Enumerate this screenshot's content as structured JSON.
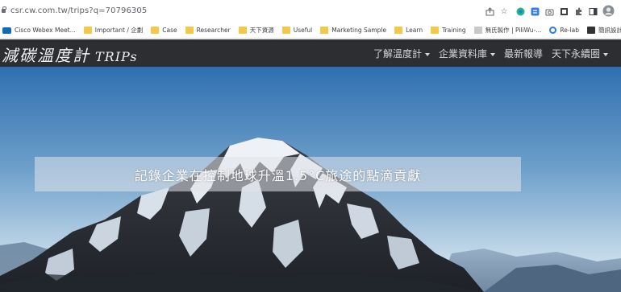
{
  "browser": {
    "url": "csr.cw.com.tw/trips?q=70796305",
    "extension_icons": [
      "share-icon",
      "star-icon",
      "color-ext-icon",
      "sync-ext-icon",
      "camera-icon",
      "square-ext-icon",
      "puzzle-icon",
      "sidepanel-icon",
      "profile-avatar-icon"
    ],
    "bookmarks": [
      {
        "label": "Cisco Webex Meet...",
        "icon": "cisco-icon"
      },
      {
        "label": "Important / 企劃",
        "icon": "folder-icon"
      },
      {
        "label": "Case",
        "icon": "folder-icon"
      },
      {
        "label": "Researcher",
        "icon": "folder-icon"
      },
      {
        "label": "天下資源",
        "icon": "folder-icon"
      },
      {
        "label": "Useful",
        "icon": "folder-icon"
      },
      {
        "label": "Marketing Sample",
        "icon": "folder-icon"
      },
      {
        "label": "Learn",
        "icon": "folder-icon"
      },
      {
        "label": "Training",
        "icon": "folder-icon"
      },
      {
        "label": "無氏製作 | PiliWu-...",
        "icon": "page-icon"
      },
      {
        "label": "Re-lab",
        "icon": "relab-icon"
      },
      {
        "label": "簡訊設計",
        "icon": "dark-icon"
      }
    ]
  },
  "site": {
    "brand_cn": "減碳溫度計",
    "brand_en": "TRIPs",
    "menu": [
      {
        "label": "了解溫度計",
        "dropdown": true
      },
      {
        "label": "企業資料庫",
        "dropdown": true
      },
      {
        "label": "最新報導",
        "dropdown": false
      },
      {
        "label": "天下永續圈",
        "dropdown": true
      }
    ]
  },
  "hero": {
    "banner_text": "記錄企業在控制地球升溫1.5°C旅途的點滴貢獻"
  },
  "colors": {
    "navbar_bg": "#2c2e32",
    "sky_top": "#2f6fb0",
    "sky_bottom": "#cfe0ee"
  }
}
